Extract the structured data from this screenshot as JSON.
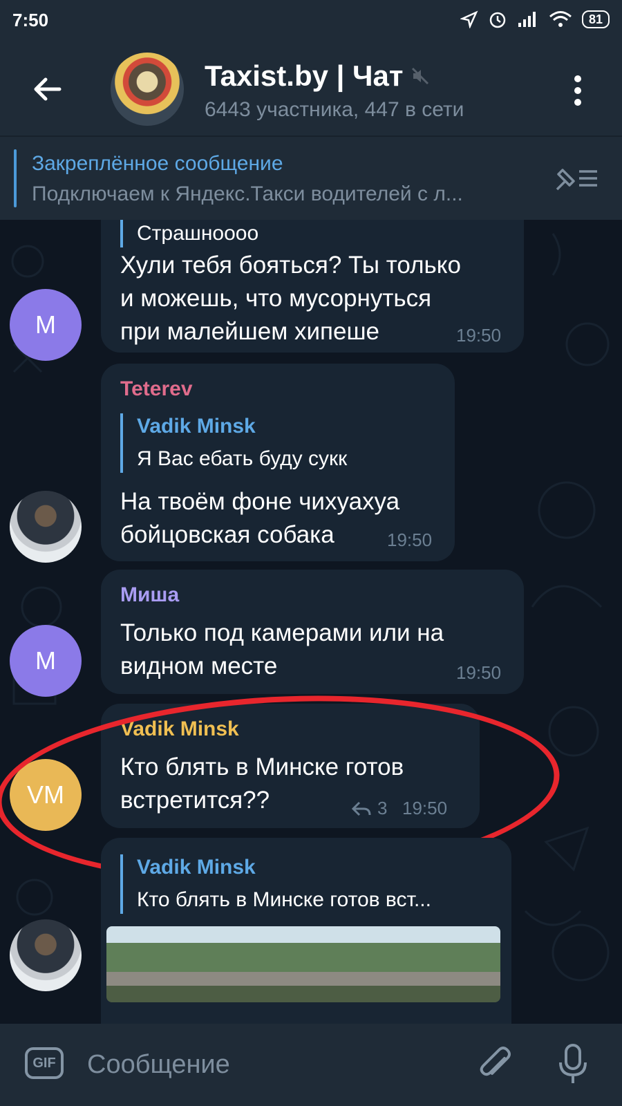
{
  "status": {
    "time": "7:50",
    "battery": "81"
  },
  "header": {
    "title": "Taxist.by | Чат",
    "subtitle": "6443 участника, 447 в сети"
  },
  "pinned": {
    "title": "Закреплённое сообщение",
    "text": "Подключаем к Яндекс.Такси водителей с л..."
  },
  "messages": [
    {
      "quote_text": "Страшноооо",
      "lines": [
        "Хули тебя бояться? Ты только",
        "и можешь, что мусорнуться",
        "при малейшем хипеше"
      ],
      "time": "19:50",
      "avatar_initials": "М",
      "avatar_color": "#8b7ae8"
    },
    {
      "sender": "Teterev",
      "sender_color": "#e06c8c",
      "quote_name": "Vadik Minsk",
      "quote_text": "Я Вас ебать буду сукк",
      "lines": [
        "На твоём фоне чихуахуа",
        "бойцовская собака"
      ],
      "time": "19:50"
    },
    {
      "sender": "Миша",
      "sender_color": "#a99cf2",
      "lines": [
        "Только под камерами или на",
        "видном месте"
      ],
      "time": "19:50",
      "avatar_initials": "М",
      "avatar_color": "#8b7ae8"
    },
    {
      "sender": "Vadik Minsk",
      "sender_color": "#f0bf52",
      "lines": [
        "Кто блять в Минске готов",
        "встретится??"
      ],
      "reply_count": "3",
      "time": "19:50",
      "avatar_initials": "VM",
      "avatar_color": "#e9b856"
    },
    {
      "quote_name": "Vadik Minsk",
      "quote_text": "Кто блять в Минске готов вст..."
    }
  ],
  "composer": {
    "placeholder": "Сообщение",
    "gif_label": "GIF"
  },
  "colors": {
    "accent": "#5ea9e6",
    "highlight": "#e8262d",
    "background": "#0e1621",
    "bubble": "#182533"
  }
}
